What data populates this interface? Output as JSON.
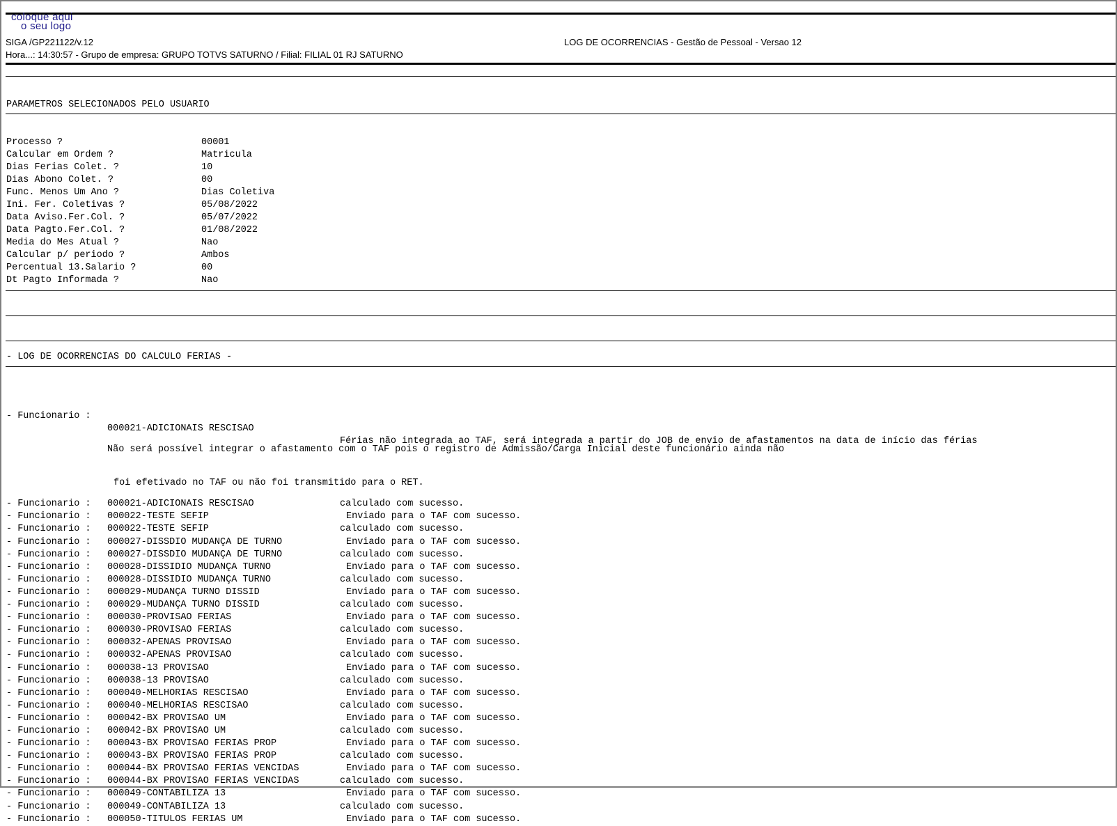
{
  "header": {
    "logo_line1": "coloque aqui",
    "logo_line2": "o seu logo",
    "program": "SIGA /GP221122/v.12",
    "title": "LOG DE OCORRENCIAS - Gestão de Pessoal - Versao 12",
    "time_line": "Hora...: 14:30:57 - Grupo de empresa: GRUPO TOTVS SATURNO / Filial: FILIAL 01 RJ SATURNO"
  },
  "params": {
    "section_title": "PARAMETROS SELECIONADOS PELO USUARIO",
    "rows": [
      {
        "label": "Processo ?",
        "value": "00001"
      },
      {
        "label": "Calcular em Ordem ?",
        "value": "Matricula"
      },
      {
        "label": "Dias Ferias Colet. ?",
        "value": "10"
      },
      {
        "label": "Dias Abono Colet. ?",
        "value": "00"
      },
      {
        "label": "Func. Menos Um Ano ?",
        "value": "Dias Coletiva"
      },
      {
        "label": "Ini. Fer. Coletivas ?",
        "value": "05/08/2022"
      },
      {
        "label": "Data Aviso.Fer.Col. ?",
        "value": "05/07/2022"
      },
      {
        "label": "Data Pagto.Fer.Col. ?",
        "value": "01/08/2022"
      },
      {
        "label": "Media do Mes Atual ?",
        "value": "Nao"
      },
      {
        "label": "Calcular p/ periodo ?",
        "value": "Ambos"
      },
      {
        "label": "Percentual 13.Salario ?",
        "value": "00"
      },
      {
        "label": "Dt Pagto Informada ?",
        "value": "Nao"
      }
    ]
  },
  "log": {
    "section_title": "- LOG DE OCORRENCIAS DO CALCULO FERIAS -",
    "prefix": "- Funcionario :",
    "first_entry": {
      "employee": "000021-ADICIONAIS RESCISAO",
      "message": "Férias não integrada ao TAF, será integrada a partir do JOB de envio de afastamentos na data de início das férias",
      "cont1": "Não será possível integrar o afastamento com o TAF pois o registro de Admissão/Carga Inicial deste funcionário ainda não",
      "cont2": "foi efetivado no TAF ou não foi transmitido para o RET."
    },
    "entries": [
      {
        "employee": "000021-ADICIONAIS RESCISAO",
        "message": "calculado com sucesso."
      },
      {
        "employee": "000022-TESTE SEFIP",
        "message": "Enviado para o TAF com sucesso."
      },
      {
        "employee": "000022-TESTE SEFIP",
        "message": "calculado com sucesso."
      },
      {
        "employee": "000027-DISSDIO MUDANÇA DE TURNO",
        "message": "Enviado para o TAF com sucesso."
      },
      {
        "employee": "000027-DISSDIO MUDANÇA DE TURNO",
        "message": "calculado com sucesso."
      },
      {
        "employee": "000028-DISSIDIO MUDANÇA TURNO",
        "message": "Enviado para o TAF com sucesso."
      },
      {
        "employee": "000028-DISSIDIO MUDANÇA TURNO",
        "message": "calculado com sucesso."
      },
      {
        "employee": "000029-MUDANÇA TURNO DISSID",
        "message": "Enviado para o TAF com sucesso."
      },
      {
        "employee": "000029-MUDANÇA TURNO DISSID",
        "message": "calculado com sucesso."
      },
      {
        "employee": "000030-PROVISAO FERIAS",
        "message": "Enviado para o TAF com sucesso."
      },
      {
        "employee": "000030-PROVISAO FERIAS",
        "message": "calculado com sucesso."
      },
      {
        "employee": "000032-APENAS PROVISAO",
        "message": "Enviado para o TAF com sucesso."
      },
      {
        "employee": "000032-APENAS PROVISAO",
        "message": "calculado com sucesso."
      },
      {
        "employee": "000038-13 PROVISAO",
        "message": "Enviado para o TAF com sucesso."
      },
      {
        "employee": "000038-13 PROVISAO",
        "message": "calculado com sucesso."
      },
      {
        "employee": "000040-MELHORIAS RESCISAO",
        "message": "Enviado para o TAF com sucesso."
      },
      {
        "employee": "000040-MELHORIAS RESCISAO",
        "message": "calculado com sucesso."
      },
      {
        "employee": "000042-BX PROVISAO UM",
        "message": "Enviado para o TAF com sucesso."
      },
      {
        "employee": "000042-BX PROVISAO UM",
        "message": "calculado com sucesso."
      },
      {
        "employee": "000043-BX PROVISAO FERIAS PROP",
        "message": "Enviado para o TAF com sucesso."
      },
      {
        "employee": "000043-BX PROVISAO FERIAS PROP",
        "message": "calculado com sucesso."
      },
      {
        "employee": "000044-BX PROVISAO FERIAS VENCIDAS",
        "message": "Enviado para o TAF com sucesso."
      },
      {
        "employee": "000044-BX PROVISAO FERIAS VENCIDAS",
        "message": "calculado com sucesso."
      },
      {
        "employee": "000049-CONTABILIZA 13",
        "message": "Enviado para o TAF com sucesso."
      },
      {
        "employee": "000049-CONTABILIZA 13",
        "message": "calculado com sucesso."
      },
      {
        "employee": "000050-TITULOS FERIAS UM",
        "message": "Enviado para o TAF com sucesso."
      }
    ]
  }
}
